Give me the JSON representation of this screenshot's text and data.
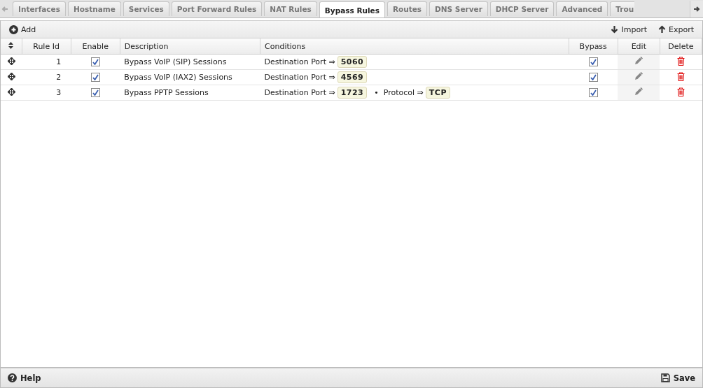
{
  "tabs": [
    {
      "label": "Interfaces",
      "selected": false
    },
    {
      "label": "Hostname",
      "selected": false
    },
    {
      "label": "Services",
      "selected": false
    },
    {
      "label": "Port Forward Rules",
      "selected": false
    },
    {
      "label": "NAT Rules",
      "selected": false
    },
    {
      "label": "Bypass Rules",
      "selected": true
    },
    {
      "label": "Routes",
      "selected": false
    },
    {
      "label": "DNS Server",
      "selected": false
    },
    {
      "label": "DHCP Server",
      "selected": false
    },
    {
      "label": "Advanced",
      "selected": false
    },
    {
      "label": "Trou",
      "selected": false
    }
  ],
  "toolbar": {
    "add": "Add",
    "import": "Import",
    "export": "Export"
  },
  "table": {
    "columns": [
      "Rule Id",
      "Enable",
      "Description",
      "Conditions",
      "Bypass",
      "Edit",
      "Delete"
    ],
    "rows": [
      {
        "rule_id": "1",
        "enabled": true,
        "description": "Bypass VoIP (SIP) Sessions",
        "conditions": [
          {
            "label": "Destination Port ⇒",
            "value": "5060"
          }
        ],
        "bypass": true
      },
      {
        "rule_id": "2",
        "enabled": true,
        "description": "Bypass VoIP (IAX2) Sessions",
        "conditions": [
          {
            "label": "Destination Port ⇒",
            "value": "4569"
          }
        ],
        "bypass": true
      },
      {
        "rule_id": "3",
        "enabled": true,
        "description": "Bypass PPTP Sessions",
        "conditions": [
          {
            "label": "Destination Port ⇒",
            "value": "1723"
          },
          {
            "separator": "•",
            "label": "Protocol ⇒",
            "value": "TCP"
          }
        ],
        "bypass": true
      }
    ]
  },
  "footer": {
    "help": "Help",
    "save": "Save"
  }
}
